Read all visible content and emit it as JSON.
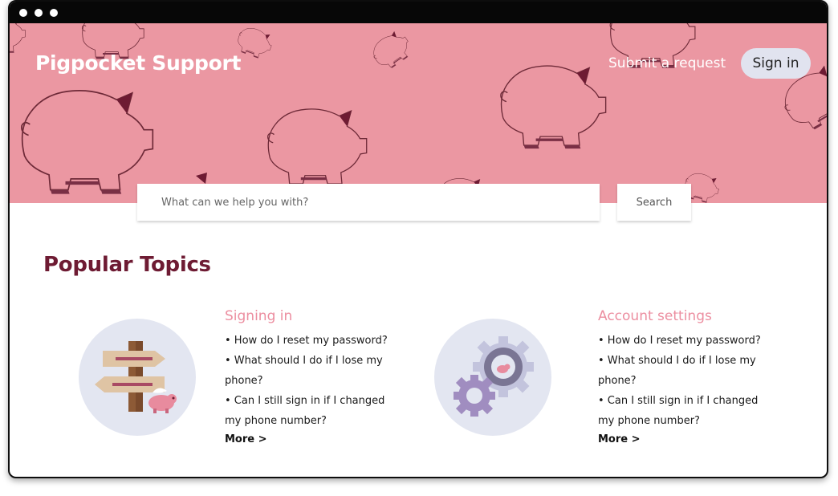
{
  "header": {
    "brand": "Pigpocket Support",
    "submit_request": "Submit a request",
    "sign_in": "Sign in"
  },
  "search": {
    "placeholder": "What can we help you with?",
    "button": "Search"
  },
  "popular_topics": {
    "title": "Popular Topics",
    "topics": [
      {
        "title": "Signing in",
        "icon": "signpost-pig-icon",
        "items": [
          "• How do I reset my password?",
          "• What should I do if I lose my phone?",
          "• Can I still sign in if I changed my phone number?"
        ],
        "more": "More >"
      },
      {
        "title": "Account settings",
        "icon": "gears-pig-icon",
        "items": [
          "• How do I reset my password?",
          "• What should I do if I lose my phone?",
          "• Can I still sign in if I changed my phone number?"
        ],
        "more": "More >"
      }
    ]
  },
  "colors": {
    "hero_pink": "#eb97a2",
    "title_maroon": "#6e1b33",
    "topic_pink": "#ec8ea0",
    "signin_bg": "#e1e3ef"
  }
}
